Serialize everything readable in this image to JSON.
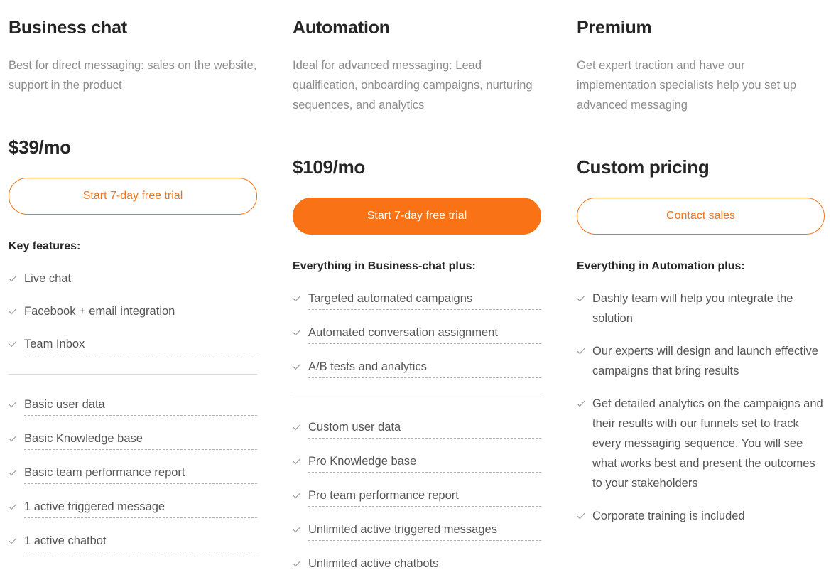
{
  "columns": [
    {
      "name": "Business chat",
      "description": "Best for direct messaging: sales on the website, support in the product",
      "price": "$39/mo",
      "cta_label": "Start 7-day free trial",
      "cta_style": "outline",
      "features_heading": "Key features:",
      "has_divider": true,
      "features_top": [
        {
          "label": "Live chat",
          "tooltip": false
        },
        {
          "label": "Facebook + email integration",
          "tooltip": false
        },
        {
          "label": "Team Inbox",
          "tooltip": true
        }
      ],
      "features_bottom": [
        {
          "label": "Basic user data",
          "tooltip": true
        },
        {
          "label": "Basic Knowledge base",
          "tooltip": true
        },
        {
          "label": "Basic team performance report",
          "tooltip": true
        },
        {
          "label": "1 active triggered message",
          "tooltip": true
        },
        {
          "label": "1 active chatbot",
          "tooltip": true
        }
      ]
    },
    {
      "name": "Automation",
      "description": "Ideal for advanced messaging: Lead qualification, onboarding campaigns, nurturing sequences, and analytics",
      "price": "$109/mo",
      "cta_label": "Start 7-day free trial",
      "cta_style": "filled",
      "features_heading": "Everything in Business-chat plus:",
      "has_divider": true,
      "features_top": [
        {
          "label": "Targeted automated campaigns",
          "tooltip": true
        },
        {
          "label": "Automated conversation assignment",
          "tooltip": true
        },
        {
          "label": "A/B tests and analytics",
          "tooltip": true
        }
      ],
      "features_bottom": [
        {
          "label": "Custom user data",
          "tooltip": true
        },
        {
          "label": "Pro Knowledge base",
          "tooltip": true
        },
        {
          "label": "Pro team performance report",
          "tooltip": true
        },
        {
          "label": "Unlimited active triggered messages",
          "tooltip": true
        },
        {
          "label": "Unlimited active chatbots",
          "tooltip": true
        }
      ]
    },
    {
      "name": "Premium",
      "description": "Get expert traction and have our implementation specialists help you set up advanced messaging",
      "price": "Custom pricing",
      "cta_label": "Contact sales",
      "cta_style": "outline",
      "features_heading": "Everything in Automation plus:",
      "has_divider": false,
      "features_top": [
        {
          "label": "Dashly team will help you integrate the solution",
          "tooltip": false
        },
        {
          "label": "Our experts will design and launch effective campaigns that bring results",
          "tooltip": false
        },
        {
          "label": "Get detailed analytics on the campaigns and their results with our funnels set to track every messaging sequence. You will see what works best and present the outcomes to your stakeholders",
          "tooltip": false
        },
        {
          "label": "Corporate training is included",
          "tooltip": false
        }
      ],
      "features_bottom": []
    }
  ],
  "icons": {
    "check": "check-icon"
  },
  "colors": {
    "accent": "#f97316",
    "heading": "#262626",
    "description": "#8c8c8c",
    "feature_text": "#555555",
    "divider": "#d9d9d9",
    "tooltip_underline": "#b0b0b0"
  }
}
